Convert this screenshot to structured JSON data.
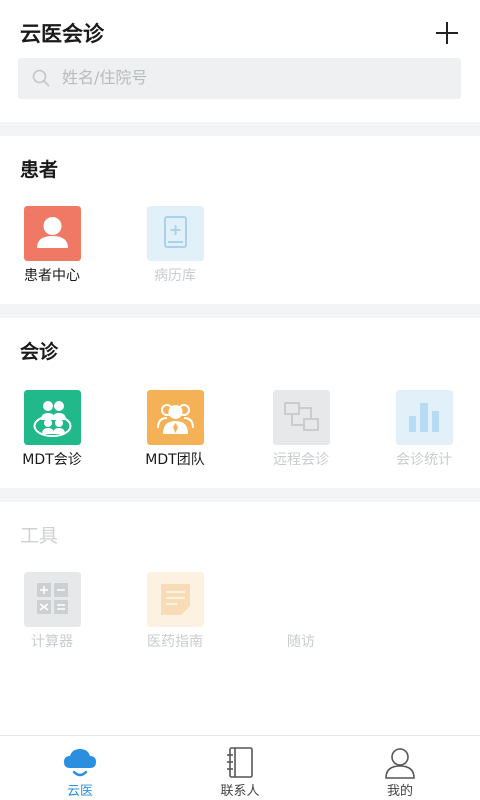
{
  "header": {
    "title": "云医会诊",
    "add_icon": "plus-icon"
  },
  "search": {
    "placeholder": "姓名/住院号",
    "icon": "search-icon"
  },
  "sections": {
    "patient": {
      "title": "患者",
      "items": [
        {
          "label": "患者中心",
          "icon": "patient-center-icon",
          "color": "#f07966",
          "enabled": true
        },
        {
          "label": "病历库",
          "icon": "medical-record-icon",
          "color": "#e2f0fa",
          "enabled": false
        }
      ]
    },
    "consult": {
      "title": "会诊",
      "items": [
        {
          "label": "MDT会诊",
          "icon": "mdt-consult-icon",
          "color": "#21b98a",
          "enabled": true
        },
        {
          "label": "MDT团队",
          "icon": "mdt-team-icon",
          "color": "#f4b155",
          "enabled": true
        },
        {
          "label": "远程会诊",
          "icon": "remote-consult-icon",
          "color": "#e6e8ea",
          "enabled": false
        },
        {
          "label": "会诊统计",
          "icon": "consult-stats-icon",
          "color": "#e2f0fa",
          "enabled": false
        }
      ]
    },
    "tools": {
      "title": "工具",
      "items": [
        {
          "label": "计算器",
          "icon": "calculator-icon",
          "color": "#e6e8ea",
          "enabled": false
        },
        {
          "label": "医药指南",
          "icon": "medicine-guide-icon",
          "color": "#fdf1e2",
          "enabled": false
        },
        {
          "label": "随访",
          "icon": "",
          "color": "",
          "enabled": false
        }
      ]
    }
  },
  "bottom_nav": {
    "items": [
      {
        "label": "云医",
        "icon": "cloud-icon",
        "active": true
      },
      {
        "label": "联系人",
        "icon": "contacts-book-icon",
        "active": false
      },
      {
        "label": "我的",
        "icon": "user-profile-icon",
        "active": false
      }
    ],
    "active_color": "#2b8fe0"
  }
}
